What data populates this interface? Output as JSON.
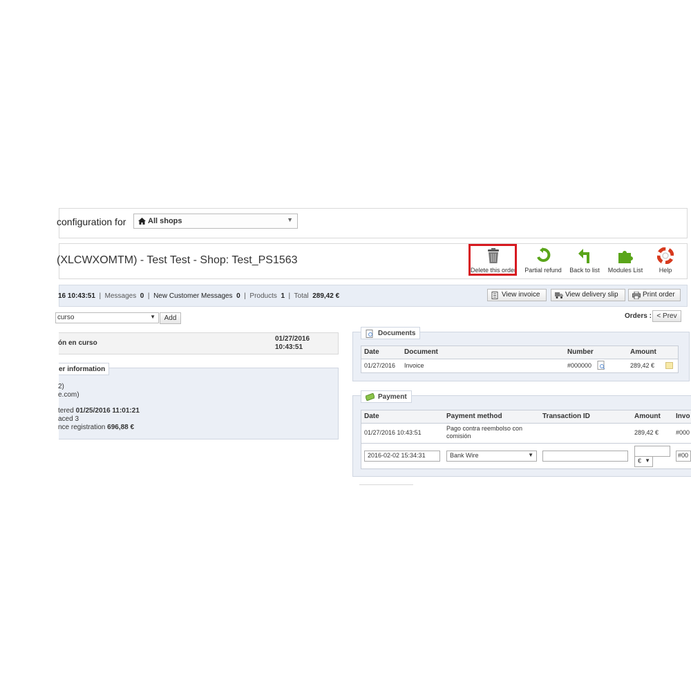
{
  "shop_context": {
    "label": "configuration for",
    "selected": "All shops"
  },
  "title": "(XLCWXOMTM) - Test Test - Shop: Test_PS1563",
  "toolbar": {
    "delete": "Delete this order",
    "partial_refund": "Partial refund",
    "back": "Back to list",
    "modules": "Modules List",
    "help": "Help"
  },
  "info": {
    "date": "16 10:43:51",
    "messages_label": "Messages",
    "messages_value": "0",
    "new_messages_label": "New Customer Messages",
    "new_messages_value": "0",
    "products_label": "Products",
    "products_value": "1",
    "total_label": "Total",
    "total_value": "289,42 €",
    "view_invoice": "View invoice",
    "view_delivery_slip": "View delivery slip",
    "print_order": "Print order"
  },
  "status": {
    "selected": "curso",
    "add": "Add"
  },
  "orders_nav": {
    "label": "Orders :",
    "prev": "< Prev"
  },
  "history": {
    "status": "ón en curso",
    "date": "01/27/2016",
    "time": "10:43:51"
  },
  "customer": {
    "legend": "er information",
    "line1": "2)",
    "line2": "e.com)",
    "registered_label": "tered",
    "registered_value": "01/25/2016 11:01:21",
    "placed_label": "aced",
    "placed_value": "3",
    "since_label": "nce registration",
    "since_value": "696,88 €"
  },
  "documents": {
    "legend": "Documents",
    "headers": [
      "Date",
      "Document",
      "Number",
      "Amount"
    ],
    "rows": [
      {
        "date": "01/27/2016",
        "document": "Invoice",
        "number": "#000000",
        "amount": "289,42 €"
      }
    ]
  },
  "payment": {
    "legend": "Payment",
    "headers": [
      "Date",
      "Payment method",
      "Transaction ID",
      "Amount",
      "Invo"
    ],
    "row": {
      "date": "01/27/2016 10:43:51",
      "method_line1": "Pago contra reembolso con",
      "method_line2": "comisión",
      "amount": "289,42 €",
      "invoice": "#000"
    },
    "form": {
      "date": "2016-02-02 15:34:31",
      "method": "Bank Wire",
      "transaction": "",
      "amount": "",
      "currency": "€",
      "invoice": "#00"
    }
  }
}
